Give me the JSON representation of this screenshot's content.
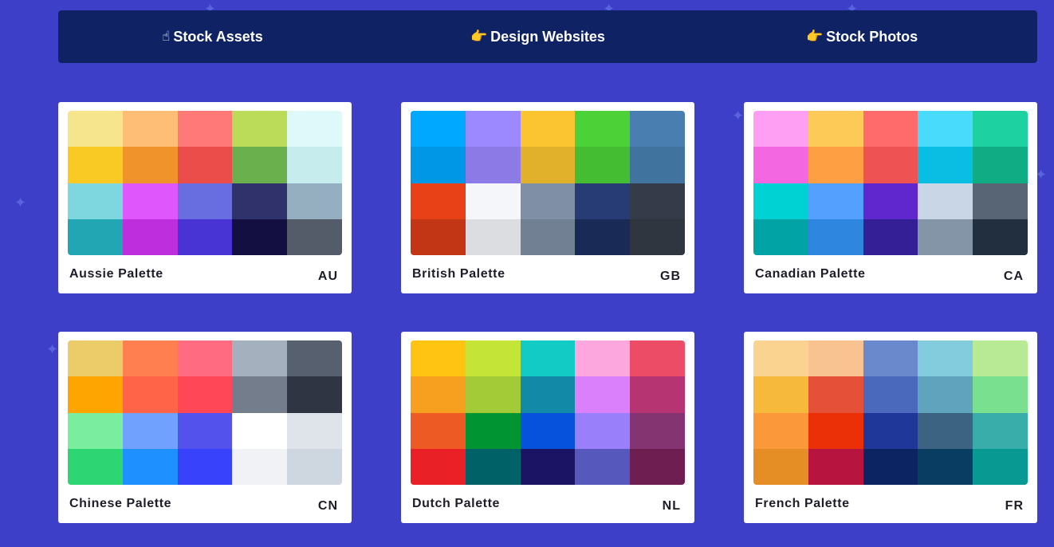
{
  "nav": {
    "items": [
      {
        "icon": "☝",
        "icon_name": "pointing-up-hand-icon",
        "label": "Stock Assets"
      },
      {
        "icon": "👉",
        "icon_name": "pointing-right-hand-icon",
        "label": "Design Websites"
      },
      {
        "icon": "👉",
        "icon_name": "pointing-right-hand-icon",
        "label": "Stock Photos"
      }
    ]
  },
  "palettes": [
    {
      "name": "Aussie Palette",
      "code": "AU",
      "colors": [
        "#f6e58d",
        "#ffbe76",
        "#ff7979",
        "#badc58",
        "#dff9fb",
        "#f9ca24",
        "#f0932b",
        "#eb4d4b",
        "#6ab04c",
        "#c7ecee",
        "#7ed6df",
        "#e056fd",
        "#686de0",
        "#30336b",
        "#95afc0",
        "#22a6b3",
        "#be2edd",
        "#4834d4",
        "#130f40",
        "#535c68"
      ]
    },
    {
      "name": "British Palette",
      "code": "GB",
      "colors": [
        "#00a8ff",
        "#9c88ff",
        "#fbc531",
        "#4cd137",
        "#487eb0",
        "#0097e6",
        "#8c7ae6",
        "#e1b12c",
        "#44bd32",
        "#40739e",
        "#e84118",
        "#f5f6fa",
        "#7f8fa6",
        "#273c75",
        "#353b48",
        "#c23616",
        "#dcdde1",
        "#718093",
        "#192a56",
        "#2f3640"
      ]
    },
    {
      "name": "Canadian Palette",
      "code": "CA",
      "colors": [
        "#ff9ff3",
        "#feca57",
        "#ff6b6b",
        "#48dbfb",
        "#1dd1a1",
        "#f368e0",
        "#ff9f43",
        "#ee5253",
        "#0abde3",
        "#10ac84",
        "#00d2d3",
        "#54a0ff",
        "#5f27cd",
        "#c8d6e5",
        "#576574",
        "#01a3a4",
        "#2e86de",
        "#341f97",
        "#8395a7",
        "#222f3e"
      ]
    },
    {
      "name": "Chinese Palette",
      "code": "CN",
      "colors": [
        "#eccc68",
        "#ff7f50",
        "#ff6b81",
        "#a4b0be",
        "#57606f",
        "#ffa502",
        "#ff6348",
        "#ff4757",
        "#747d8c",
        "#2f3542",
        "#7bed9f",
        "#70a1ff",
        "#5352ed",
        "#ffffff",
        "#dfe4ea",
        "#2ed573",
        "#1e90ff",
        "#3742fa",
        "#f1f2f6",
        "#ced6e0"
      ]
    },
    {
      "name": "Dutch Palette",
      "code": "NL",
      "colors": [
        "#ffc312",
        "#c4e538",
        "#12cbc4",
        "#fda7df",
        "#ed4c67",
        "#f79f1f",
        "#a3cb38",
        "#1289a7",
        "#d980fa",
        "#b53471",
        "#ee5a24",
        "#009432",
        "#0652dd",
        "#9980fa",
        "#833471",
        "#ea2027",
        "#006266",
        "#1b1464",
        "#5758bb",
        "#6f1e51"
      ]
    },
    {
      "name": "French Palette",
      "code": "FR",
      "colors": [
        "#fad390",
        "#f8c291",
        "#6a89cc",
        "#82ccdd",
        "#b8e994",
        "#f6b93b",
        "#e55039",
        "#4a69bd",
        "#60a3bc",
        "#78e08f",
        "#fa983a",
        "#eb2f06",
        "#1e3799",
        "#3c6382",
        "#38ada9",
        "#e58e26",
        "#b71540",
        "#0c2461",
        "#0a3d62",
        "#079992"
      ]
    }
  ]
}
